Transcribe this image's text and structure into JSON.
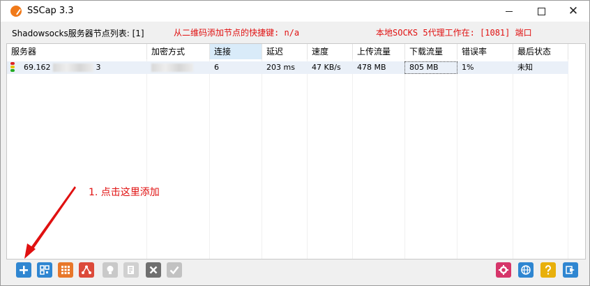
{
  "window": {
    "title": "SSCap 3.3"
  },
  "infobar": {
    "list_label": "Shadowsocks服务器节点列表: [1]",
    "qr_hotkey_hint": "从二维码添加节点的快捷键: n/a",
    "local_proxy_info": "本地SOCKS 5代理工作在: [1081] 端口"
  },
  "table": {
    "columns": [
      "服务器",
      "加密方式",
      "连接",
      "延迟",
      "速度",
      "上传流量",
      "下载流量",
      "错误率",
      "最后状态"
    ],
    "rows": [
      {
        "server": "69.162",
        "server_suffix": "3",
        "encryption": "",
        "connections": "6",
        "latency": "203 ms",
        "speed": "47 KB/s",
        "upload": "478 MB",
        "download": "805 MB",
        "error_rate": "1%",
        "last_status": "未知"
      }
    ]
  },
  "annotation": {
    "text": "1. 点击这里添加"
  },
  "colors": {
    "annotation": "#e01010",
    "active_header": "#d9ebf9",
    "row_highlight": "#eaf0f8"
  },
  "toolbar": {
    "left_buttons": [
      "add-icon",
      "qr-code-icon",
      "grid-icon",
      "share-icon",
      "lightbulb-icon",
      "edit-icon",
      "delete-icon",
      "check-icon"
    ],
    "right_buttons": [
      "settings-icon",
      "globe-icon",
      "help-icon",
      "exit-icon"
    ]
  }
}
